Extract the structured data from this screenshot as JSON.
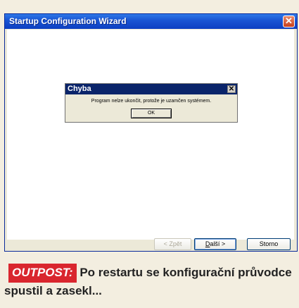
{
  "window": {
    "title": "Startup Configuration Wizard",
    "close_glyph": "✕",
    "buttons": {
      "back": "< Zpět",
      "next_hotkey": "D",
      "next_rest": "alší >",
      "cancel": "Storno"
    }
  },
  "dialog": {
    "title": "Chyba",
    "close_glyph": "✕",
    "message": "Program nelze ukončit, protože je uzamčen systémem.",
    "ok": "OK"
  },
  "caption": {
    "badge": "OUTPOST:",
    "text": "Po restartu se konfigurační průvodce spustil a zasekl..."
  },
  "colors": {
    "titlebar": "#1a56d4",
    "badge": "#d9262e",
    "caption_bg": "#f3eee0"
  }
}
